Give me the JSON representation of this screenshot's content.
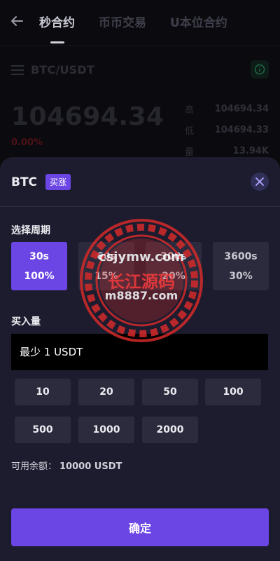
{
  "nav": {
    "back_icon": "arrow-left-icon",
    "tabs": [
      {
        "label": "秒合约",
        "active": true
      },
      {
        "label": "币币交易",
        "active": false
      },
      {
        "label": "U本位合约",
        "active": false
      }
    ]
  },
  "market": {
    "pair": "BTC/USDT",
    "price": "104694.34",
    "change": "0.00%",
    "stats": [
      {
        "label": "高",
        "value": "104694.34"
      },
      {
        "label": "低",
        "value": "104694.33"
      },
      {
        "label": "量",
        "value": "13.94K"
      }
    ]
  },
  "sheet": {
    "asset": "BTC",
    "direction_badge": "买涨",
    "period_title": "选择周期",
    "periods": [
      {
        "time": "30s",
        "rate": "100%",
        "selected": true
      },
      {
        "time": "60s",
        "rate": "15%",
        "selected": false
      },
      {
        "time": "300s",
        "rate": "20%",
        "selected": false
      },
      {
        "time": "3600s",
        "rate": "30%",
        "selected": false
      }
    ],
    "amount_title": "买入量",
    "amount_placeholder": "最少 1 USDT",
    "quick_amounts": [
      "10",
      "20",
      "50",
      "100",
      "500",
      "1000",
      "2000"
    ],
    "balance_label": "可用余额：",
    "balance_value": "10000 USDT",
    "confirm_label": "确定"
  },
  "watermark": {
    "line1": "csjymw.com",
    "line2": "长江源码",
    "line3": "m8887.com"
  },
  "colors": {
    "accent": "#6b46e5",
    "sheet_bg": "#1c1c2e",
    "tile_bg": "#2b2b3d",
    "watermark_red": "#d42a2a"
  }
}
